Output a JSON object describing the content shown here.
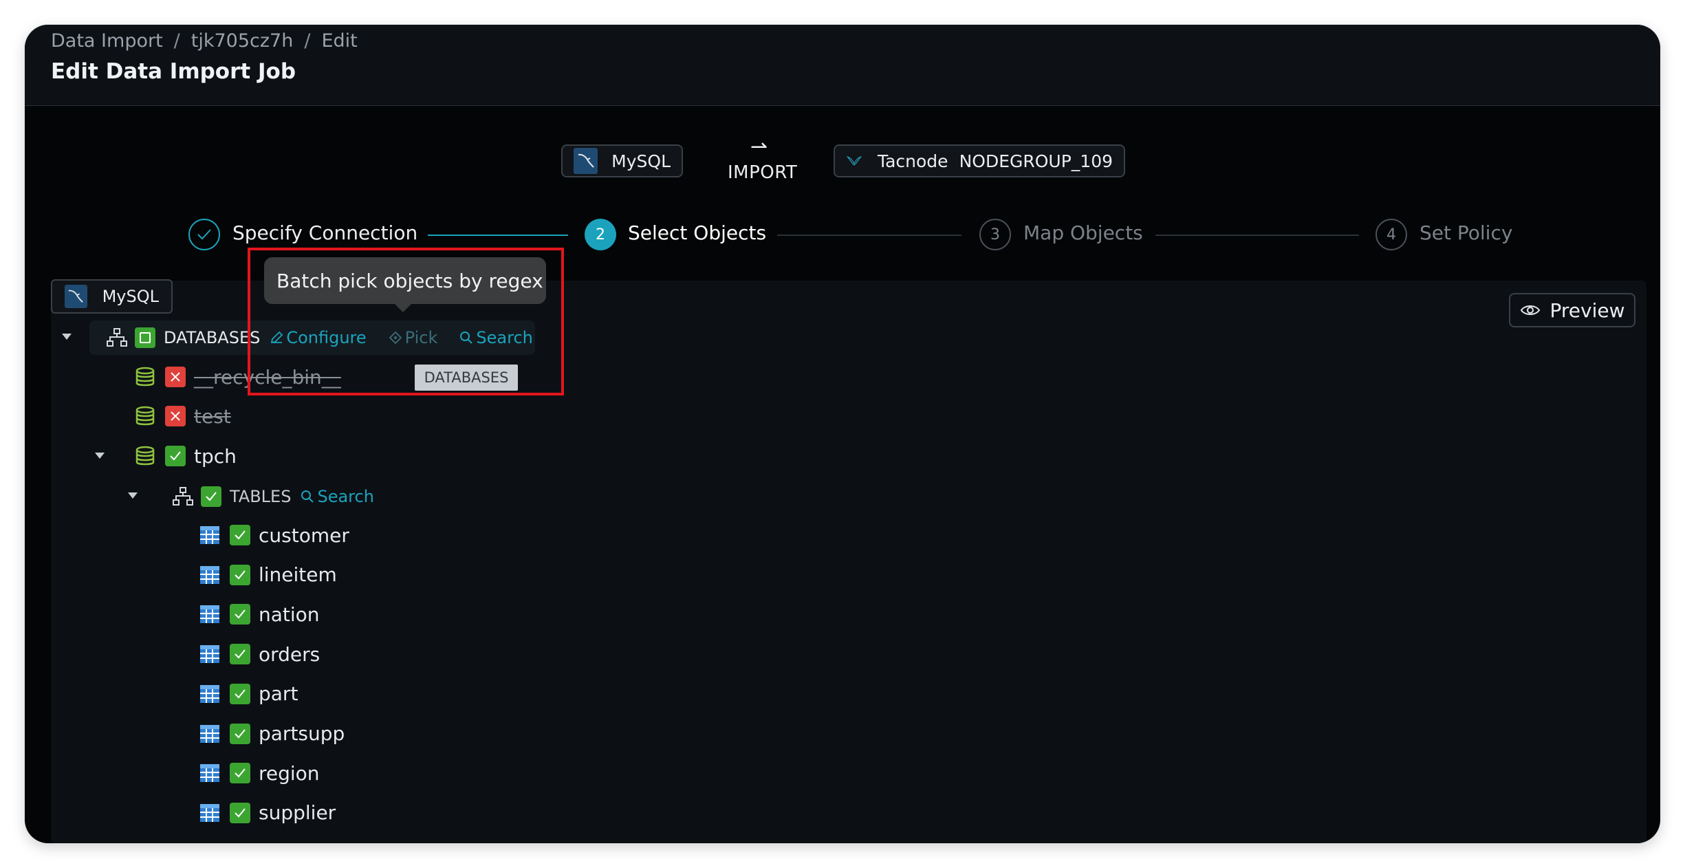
{
  "breadcrumb": {
    "items": [
      "Data Import",
      "tjk705cz7h",
      "Edit"
    ],
    "separator": "/"
  },
  "page_title": "Edit Data Import Job",
  "connection": {
    "source_label": "MySQL",
    "arrow": "⇀",
    "import_label": "IMPORT",
    "target_brand": "Tacnode",
    "target_nodegroup": "NODEGROUP_109"
  },
  "steps": [
    {
      "number": "1",
      "label": "Specify Connection",
      "status": "done"
    },
    {
      "number": "2",
      "label": "Select Objects",
      "status": "active"
    },
    {
      "number": "3",
      "label": "Map Objects",
      "status": "todo"
    },
    {
      "number": "4",
      "label": "Set Policy",
      "status": "todo"
    }
  ],
  "source_chip": "MySQL",
  "preview_label": "Preview",
  "tree": {
    "databases_label": "DATABASES",
    "db_actions": {
      "configure": "Configure",
      "pick": "Pick",
      "search": "Search"
    },
    "databases": [
      {
        "name": "__recycle_bin__",
        "state": "excluded"
      },
      {
        "name": "test",
        "state": "excluded"
      },
      {
        "name": "tpch",
        "state": "included"
      }
    ],
    "tables_label": "TABLES",
    "tables_search": "Search",
    "tables": [
      "customer",
      "lineitem",
      "nation",
      "orders",
      "part",
      "partsupp",
      "region",
      "supplier"
    ]
  },
  "tooltip": "Batch pick objects by regex",
  "hover_tag": "DATABASES",
  "colors": {
    "accent": "#1ba3bd",
    "check_green": "#3ca531",
    "exclude_red": "#e0413b",
    "highlight": "#e2161c"
  }
}
